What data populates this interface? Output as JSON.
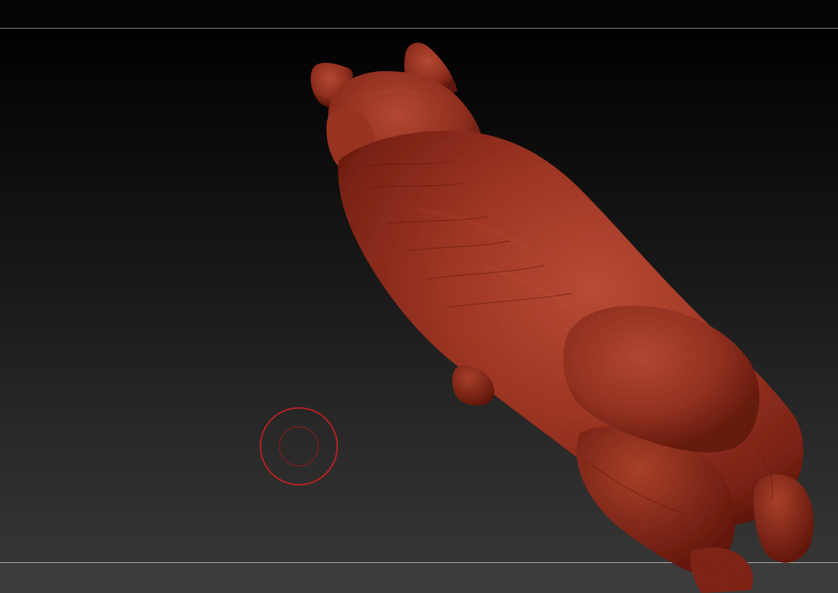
{
  "viewport": {
    "background_top": "#000000",
    "background_bottom": "#353535",
    "top_bar_color": "#050505",
    "bottom_bar_color": "#3c3c3c",
    "frame_line_color": "#8a8a8a"
  },
  "model": {
    "icon": "sculpted-dog-mesh",
    "material_color": "#b3402c",
    "highlight_color": "#d86a52",
    "shadow_color": "#6e1e14"
  },
  "brush": {
    "icon": "brush-cursor-icon",
    "outer_ring_color": "#c02020",
    "inner_ring_color": "#8a1a1a"
  }
}
